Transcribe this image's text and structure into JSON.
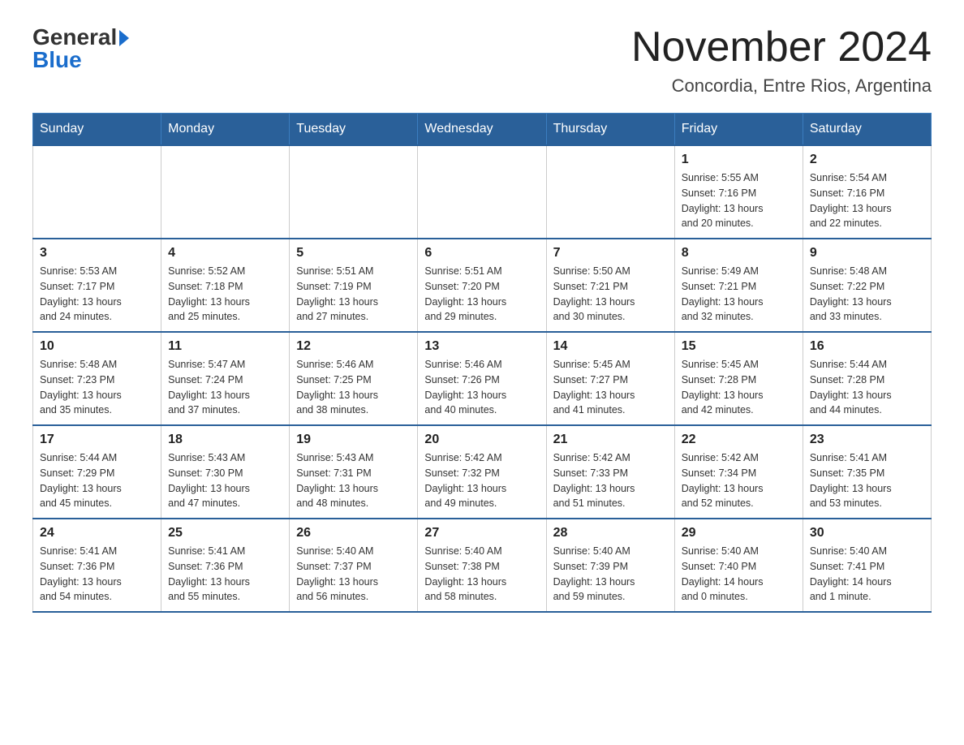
{
  "header": {
    "logo_general": "General",
    "logo_blue": "Blue",
    "month_title": "November 2024",
    "location": "Concordia, Entre Rios, Argentina"
  },
  "days_of_week": [
    "Sunday",
    "Monday",
    "Tuesday",
    "Wednesday",
    "Thursday",
    "Friday",
    "Saturday"
  ],
  "weeks": [
    [
      {
        "day": "",
        "info": ""
      },
      {
        "day": "",
        "info": ""
      },
      {
        "day": "",
        "info": ""
      },
      {
        "day": "",
        "info": ""
      },
      {
        "day": "",
        "info": ""
      },
      {
        "day": "1",
        "info": "Sunrise: 5:55 AM\nSunset: 7:16 PM\nDaylight: 13 hours\nand 20 minutes."
      },
      {
        "day": "2",
        "info": "Sunrise: 5:54 AM\nSunset: 7:16 PM\nDaylight: 13 hours\nand 22 minutes."
      }
    ],
    [
      {
        "day": "3",
        "info": "Sunrise: 5:53 AM\nSunset: 7:17 PM\nDaylight: 13 hours\nand 24 minutes."
      },
      {
        "day": "4",
        "info": "Sunrise: 5:52 AM\nSunset: 7:18 PM\nDaylight: 13 hours\nand 25 minutes."
      },
      {
        "day": "5",
        "info": "Sunrise: 5:51 AM\nSunset: 7:19 PM\nDaylight: 13 hours\nand 27 minutes."
      },
      {
        "day": "6",
        "info": "Sunrise: 5:51 AM\nSunset: 7:20 PM\nDaylight: 13 hours\nand 29 minutes."
      },
      {
        "day": "7",
        "info": "Sunrise: 5:50 AM\nSunset: 7:21 PM\nDaylight: 13 hours\nand 30 minutes."
      },
      {
        "day": "8",
        "info": "Sunrise: 5:49 AM\nSunset: 7:21 PM\nDaylight: 13 hours\nand 32 minutes."
      },
      {
        "day": "9",
        "info": "Sunrise: 5:48 AM\nSunset: 7:22 PM\nDaylight: 13 hours\nand 33 minutes."
      }
    ],
    [
      {
        "day": "10",
        "info": "Sunrise: 5:48 AM\nSunset: 7:23 PM\nDaylight: 13 hours\nand 35 minutes."
      },
      {
        "day": "11",
        "info": "Sunrise: 5:47 AM\nSunset: 7:24 PM\nDaylight: 13 hours\nand 37 minutes."
      },
      {
        "day": "12",
        "info": "Sunrise: 5:46 AM\nSunset: 7:25 PM\nDaylight: 13 hours\nand 38 minutes."
      },
      {
        "day": "13",
        "info": "Sunrise: 5:46 AM\nSunset: 7:26 PM\nDaylight: 13 hours\nand 40 minutes."
      },
      {
        "day": "14",
        "info": "Sunrise: 5:45 AM\nSunset: 7:27 PM\nDaylight: 13 hours\nand 41 minutes."
      },
      {
        "day": "15",
        "info": "Sunrise: 5:45 AM\nSunset: 7:28 PM\nDaylight: 13 hours\nand 42 minutes."
      },
      {
        "day": "16",
        "info": "Sunrise: 5:44 AM\nSunset: 7:28 PM\nDaylight: 13 hours\nand 44 minutes."
      }
    ],
    [
      {
        "day": "17",
        "info": "Sunrise: 5:44 AM\nSunset: 7:29 PM\nDaylight: 13 hours\nand 45 minutes."
      },
      {
        "day": "18",
        "info": "Sunrise: 5:43 AM\nSunset: 7:30 PM\nDaylight: 13 hours\nand 47 minutes."
      },
      {
        "day": "19",
        "info": "Sunrise: 5:43 AM\nSunset: 7:31 PM\nDaylight: 13 hours\nand 48 minutes."
      },
      {
        "day": "20",
        "info": "Sunrise: 5:42 AM\nSunset: 7:32 PM\nDaylight: 13 hours\nand 49 minutes."
      },
      {
        "day": "21",
        "info": "Sunrise: 5:42 AM\nSunset: 7:33 PM\nDaylight: 13 hours\nand 51 minutes."
      },
      {
        "day": "22",
        "info": "Sunrise: 5:42 AM\nSunset: 7:34 PM\nDaylight: 13 hours\nand 52 minutes."
      },
      {
        "day": "23",
        "info": "Sunrise: 5:41 AM\nSunset: 7:35 PM\nDaylight: 13 hours\nand 53 minutes."
      }
    ],
    [
      {
        "day": "24",
        "info": "Sunrise: 5:41 AM\nSunset: 7:36 PM\nDaylight: 13 hours\nand 54 minutes."
      },
      {
        "day": "25",
        "info": "Sunrise: 5:41 AM\nSunset: 7:36 PM\nDaylight: 13 hours\nand 55 minutes."
      },
      {
        "day": "26",
        "info": "Sunrise: 5:40 AM\nSunset: 7:37 PM\nDaylight: 13 hours\nand 56 minutes."
      },
      {
        "day": "27",
        "info": "Sunrise: 5:40 AM\nSunset: 7:38 PM\nDaylight: 13 hours\nand 58 minutes."
      },
      {
        "day": "28",
        "info": "Sunrise: 5:40 AM\nSunset: 7:39 PM\nDaylight: 13 hours\nand 59 minutes."
      },
      {
        "day": "29",
        "info": "Sunrise: 5:40 AM\nSunset: 7:40 PM\nDaylight: 14 hours\nand 0 minutes."
      },
      {
        "day": "30",
        "info": "Sunrise: 5:40 AM\nSunset: 7:41 PM\nDaylight: 14 hours\nand 1 minute."
      }
    ]
  ]
}
